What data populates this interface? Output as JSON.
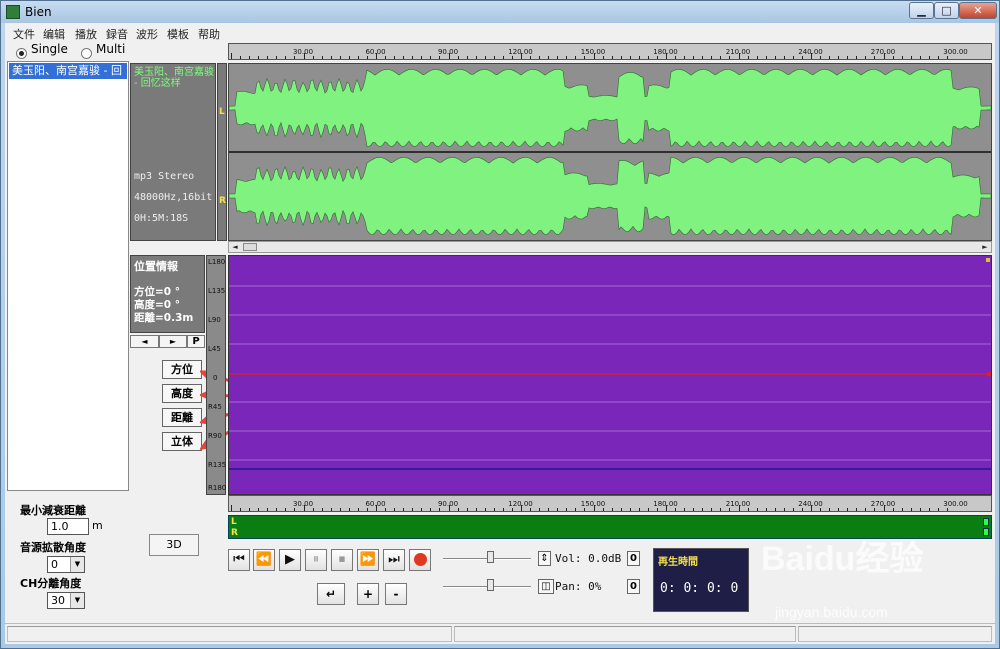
{
  "window": {
    "title": "Bien",
    "min_glyph": "▁",
    "max_glyph": "□",
    "close_glyph": "✕"
  },
  "menu": [
    "文件",
    "编辑",
    "播放",
    "録音",
    "波形",
    "模板",
    "帮助"
  ],
  "mode": {
    "single_label": "Single",
    "multi_label": "Multi",
    "selected": "single"
  },
  "playlist": {
    "items": [
      "美玉阳、南宫嘉骏 - 回"
    ]
  },
  "ruler": {
    "ticks": [
      "30.00",
      "60.00",
      "90.00",
      "120.00",
      "150.00",
      "180.00",
      "210.00",
      "240.00",
      "270.00",
      "300.00"
    ]
  },
  "track_info": {
    "title": "美玉阳、南宫嘉骏 - 回忆这样",
    "format": "mp3 Stereo",
    "rate": "48000Hz,16bit",
    "duration": "0H:5M:18S",
    "channel_l": "L",
    "channel_r": "R"
  },
  "waveform": {
    "color": "#7ff27f",
    "background": "#8f8f8f",
    "centerline": "#222222"
  },
  "position": {
    "title": "位置情報",
    "azimuth": "方位=0 °",
    "elevation": "高度=0 °",
    "distance": "距離=0.3m"
  },
  "nav": {
    "prev": "◄",
    "next": "►",
    "p": "P"
  },
  "side_buttons": {
    "azimuth": "方位",
    "elevation": "高度",
    "distance": "距離",
    "stereo": "立体"
  },
  "angle_scale": [
    "L180",
    "L135",
    "L90",
    "L45",
    "0",
    "R45",
    "R90",
    "R135",
    "R180"
  ],
  "spatial": {
    "background": "#7a27b9",
    "red_line": "#e02020",
    "blue_line": "#1c1c8a"
  },
  "meter": {
    "l": "L",
    "r": "R",
    "color": "#0a7e12"
  },
  "params": {
    "min_dist_label": "最小減衰距離",
    "min_dist_value": "1.0",
    "min_dist_unit": "m",
    "spread_label": "音源拡散角度",
    "spread_value": "0",
    "ch_sep_label": "CH分離角度",
    "ch_sep_value": "30",
    "dd": "▼"
  },
  "btn_3d": "3D",
  "transport": {
    "first": "⏮",
    "rewind": "⏪",
    "play": "▶",
    "pause": "⏸",
    "stop": "⏹",
    "forward": "⏩",
    "last": "⏭",
    "loop": "↵",
    "plus": "+",
    "minus": "-"
  },
  "volume": {
    "label": "Vol: 0.0dB",
    "zero": "0",
    "updown": "⇕"
  },
  "pan": {
    "label": "Pan: 0%",
    "zero": "0",
    "icon": "◫"
  },
  "playtime": {
    "title": "再生時間",
    "value": "0: 0: 0:  0"
  },
  "watermark": {
    "brand": "Baidu经验",
    "url": "jingyan.baidu.com"
  }
}
